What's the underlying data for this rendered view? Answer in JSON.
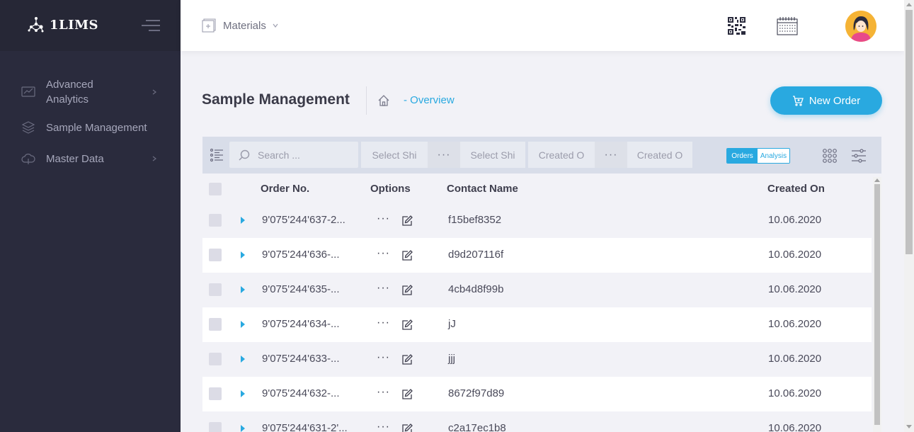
{
  "app": {
    "logo_text": "1LIMS"
  },
  "sidebar": {
    "items": [
      {
        "label": "Advanced Analytics",
        "icon": "analytics-icon",
        "has_children": true
      },
      {
        "label": "Sample Management",
        "icon": "layers-icon",
        "has_children": false
      },
      {
        "label": "Master Data",
        "icon": "cloud-icon",
        "has_children": true
      }
    ]
  },
  "header": {
    "module_label": "Materials",
    "icons": [
      "qr-code-icon",
      "calendar-icon",
      "avatar"
    ]
  },
  "page": {
    "title": "Sample Management",
    "breadcrumb": "- Overview",
    "new_order_label": "New Order"
  },
  "toolbar": {
    "search_placeholder": "Search ...",
    "filter_ship_from": "Select Shi",
    "filter_ship_to": "Select Shi",
    "filter_created_from": "Created O",
    "filter_created_to": "Created O",
    "range_dots": "···",
    "toggle_orders": "Orders",
    "toggle_analysis": "Analysis"
  },
  "table": {
    "columns": {
      "order_no": "Order No.",
      "options": "Options",
      "contact_name": "Contact Name",
      "created_on": "Created On"
    },
    "rows": [
      {
        "order_no": "9'075'244'637-2...",
        "contact": "f15bef8352",
        "created": "10.06.2020"
      },
      {
        "order_no": "9'075'244'636-...",
        "contact": "d9d207116f",
        "created": "10.06.2020"
      },
      {
        "order_no": "9'075'244'635-...",
        "contact": "4cb4d8f99b",
        "created": "10.06.2020"
      },
      {
        "order_no": "9'075'244'634-...",
        "contact": "jJ",
        "created": "10.06.2020"
      },
      {
        "order_no": "9'075'244'633-...",
        "contact": "jjj",
        "created": "10.06.2020"
      },
      {
        "order_no": "9'075'244'632-...",
        "contact": "8672f97d89",
        "created": "10.06.2020"
      },
      {
        "order_no": "9'075'244'631-2'...",
        "contact": "c2a17ec1b8",
        "created": "10.06.2020"
      }
    ],
    "row_dots": "···"
  },
  "colors": {
    "accent": "#29a9e0",
    "sidebar_bg": "#2a2b3d",
    "page_bg": "#f2f2f7"
  }
}
